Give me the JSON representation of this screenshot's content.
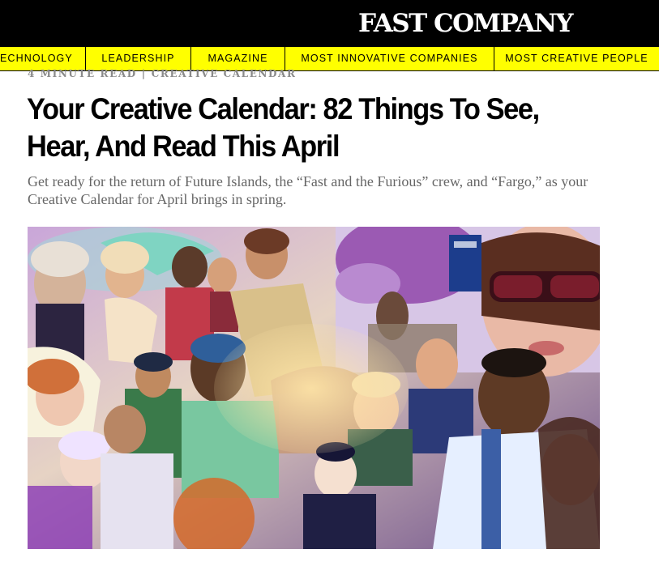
{
  "header": {
    "logo_text": "FAST COMPANY",
    "background": "#000000"
  },
  "nav": {
    "background": "#ffff00",
    "items": [
      {
        "label": "ECHNOLOGY"
      },
      {
        "label": "LEADERSHIP"
      },
      {
        "label": "MAGAZINE"
      },
      {
        "label": "MOST INNOVATIVE COMPANIES"
      },
      {
        "label": "MOST CREATIVE PEOPLE"
      }
    ]
  },
  "article": {
    "read_time": "4 MINUTE READ",
    "separator": "|",
    "category": "CREATIVE CALENDAR",
    "headline_line1": "Your Creative Calendar: 82 Things To See,",
    "headline_line2": "Hear, And Read This April",
    "dek": "Get ready for the return of Future Islands, the “Fast and the Furious” crew, and “Fargo,” as your Creative Calendar for April brings in spring."
  }
}
